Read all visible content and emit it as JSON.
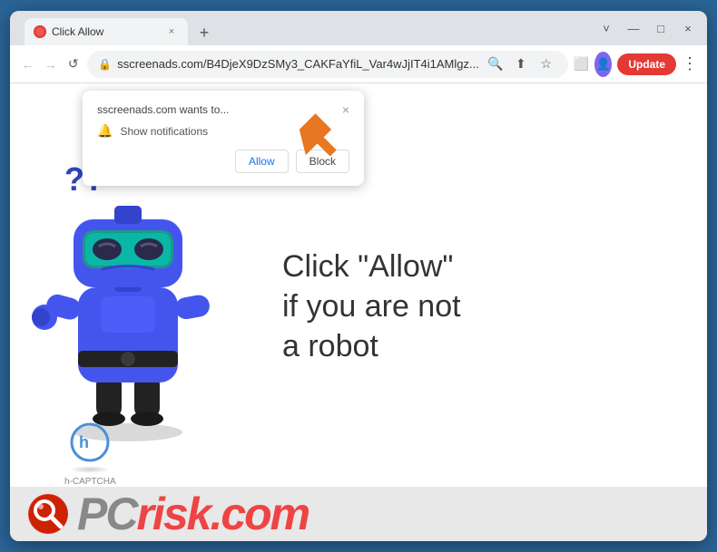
{
  "browser": {
    "title_bar": {
      "tab_title": "Click Allow",
      "favicon_alt": "site favicon",
      "close_label": "×",
      "new_tab_label": "+",
      "minimize_label": "—",
      "restore_label": "❐",
      "close_window_label": "×",
      "chevron_label": "˅",
      "maximize_label": "□"
    },
    "address_bar": {
      "back_label": "←",
      "forward_label": "→",
      "reload_label": "↺",
      "url": "sscreenads.com/B4DjeX9DzSMy3_CAKFaYfiL_Var4wJjIT4i1AMlgz...",
      "lock_icon": "🔒",
      "search_icon": "🔍",
      "share_icon": "⬆",
      "bookmark_icon": "☆",
      "extensions_icon": "⬜",
      "profile_icon": "👤",
      "update_button": "Update",
      "menu_dots": "⋮"
    }
  },
  "notification_popup": {
    "site_text": "sscreenads.com wants to...",
    "close_label": "×",
    "bell_icon": "🔔",
    "description": "Show notifications",
    "allow_button": "Allow",
    "block_button": "Block"
  },
  "page": {
    "question_marks": "??",
    "main_text_line1": "Click \"Allow\"",
    "main_text_line2": "if you are not",
    "main_text_line3": "a robot",
    "hcaptcha_label": "h-CAPTCHA"
  },
  "footer": {
    "logo_symbol": "🔍",
    "brand_pc": "PC",
    "brand_risk": "risk",
    "brand_com": ".com"
  }
}
